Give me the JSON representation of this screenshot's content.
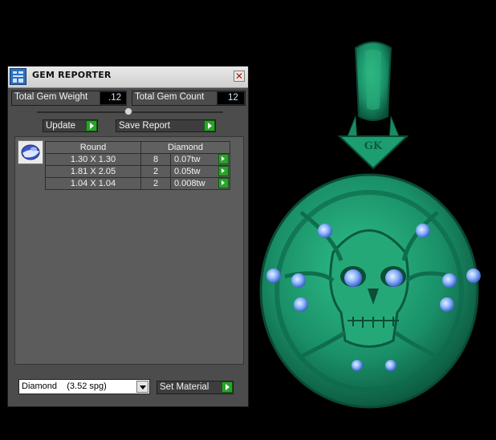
{
  "window": {
    "title": "GEM REPORTER",
    "close_icon": "close-icon",
    "app_icon": "gem-reporter-icon"
  },
  "totals": {
    "weight_label": "Total Gem Weight",
    "weight_value": ".12",
    "count_label": "Total Gem Count",
    "count_value": "12"
  },
  "toolbar": {
    "update_label": "Update",
    "save_label": "Save Report"
  },
  "gem_table": {
    "shape": "Round",
    "material": "Diamond",
    "rows": [
      {
        "size": "1.30 X 1.30",
        "count": "8",
        "weight": "0.07tw"
      },
      {
        "size": "1.81 X 2.05",
        "count": "2",
        "weight": "0.05tw"
      },
      {
        "size": "1.04 X 1.04",
        "count": "2",
        "weight": "0.008tw"
      }
    ]
  },
  "material_select": {
    "value": "Diamond    (3.52 spg)",
    "set_label": "Set Material"
  },
  "viewport": {
    "pendant_color": "#1e9a6c",
    "gem_color": "#8fb8ff",
    "engraving": "GK"
  }
}
